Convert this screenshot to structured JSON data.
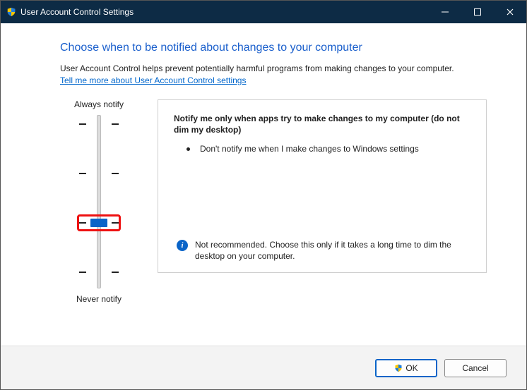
{
  "window": {
    "title": "User Account Control Settings"
  },
  "heading": "Choose when to be notified about changes to your computer",
  "description": "User Account Control helps prevent potentially harmful programs from making changes to your computer.",
  "help_link": "Tell me more about User Account Control settings",
  "slider": {
    "top_label": "Always notify",
    "bottom_label": "Never notify",
    "positions": 4,
    "selected_index": 2
  },
  "panel": {
    "title": "Notify me only when apps try to make changes to my computer (do not dim my desktop)",
    "bullet": "Don't notify me when I make changes to Windows settings",
    "note": "Not recommended. Choose this only if it takes a long time to dim the desktop on your computer."
  },
  "footer": {
    "ok": "OK",
    "cancel": "Cancel"
  }
}
